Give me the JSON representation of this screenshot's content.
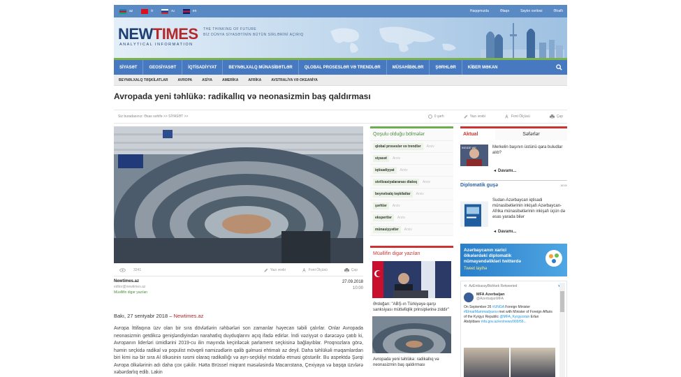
{
  "languages": [
    {
      "code": "az",
      "colors": [
        "#0092bc",
        "#e4002b",
        "#00af66"
      ]
    },
    {
      "code": "tr",
      "colors": [
        "#e30a17",
        "#e30a17",
        "#e30a17"
      ]
    },
    {
      "code": "ru",
      "colors": [
        "#ffffff",
        "#0039a6",
        "#d52b1e"
      ]
    },
    {
      "code": "en",
      "colors": [
        "#012169",
        "#c8102e",
        "#012169"
      ]
    }
  ],
  "toplinks": [
    "Haqqımızda",
    "Əlaqə",
    "Saytın xəritəsi",
    "Ətraflı"
  ],
  "logo": {
    "part1": "NEW",
    "part2": "TIMES",
    "sub": "ANALYTICAL INFORMATION"
  },
  "tagline": {
    "line1": "THE THINKING OF FUTURE",
    "line2": "BİZ DÜNYA SİYASƏTİNİN BÜTÜN SİRLƏRİNİ AÇIRIQ"
  },
  "nav": [
    "SİYASƏT",
    "GEOSİYASƏT",
    "İQTİSADİYYAT",
    "BEYNƏLXALQ MÜNASİBƏTLƏR",
    "QLOBAL PROSESLƏR VƏ TRENDLƏR",
    "MÜSAHİBƏLƏR",
    "ŞƏRHLƏR",
    "KİBER MƏKAN"
  ],
  "subnav": [
    "BEYNƏLXALQ TƏŞKİLATLAR",
    "AVROPA",
    "ASİYA",
    "AMERİKA",
    "AFRİKA",
    "AVSTRALİYA VƏ OKEANİYA"
  ],
  "article": {
    "title": "Avropada yeni təhlükə: radikallıq və neonasizmin baş qaldırması",
    "breadcrumb": "Siz buradasınız:  Əsas səhifə >> SİYASƏT >>",
    "tools": [
      "0 şərh",
      "Yazı ərəbi",
      "Font Ölçüsü",
      "Çap"
    ],
    "views": "3241",
    "photo_tools": [
      "Yazı ərəbi",
      "Font Ölçüsü",
      "Çap"
    ],
    "source_name": "Newtimes.az",
    "source_email": "editor@newtimes.az",
    "source_other": "Müəllifin digər yazıları",
    "date": "27.09.2018",
    "time": "10:00",
    "dateline_prefix": "Bakı, 27 sentyabr 2018 – ",
    "dateline_link": "Newtimes.az",
    "body": "Avropa İttifaqına üzv olan bir sıra dövlətlərin rəhbərləri son zamanlar həyecan təbili çalırlar. Onlar Avropada neonasizmin getdikcə genişləndiyindən narahatlıq duyduqlarını açıq ifadə edirlər. İndi vəziyyət o dərəcəyə çatıb ki, Avropanın liderləri ümidlərini 2019-cu ilin mayında keçiriləcək parlament seçkisinə bağlayıblar. Proqnozlara görə, həmin seçkidə radikal və populist mövqeli namizədlərin qalib gəlməsi ehtimalı az deyil. Daha təhlükəli məqamlardan biri kimi isə bir sıra Aİ ölkəsinin rəsmi olaraq radikallığı və ayrı-seçkiliyi müdafiə etməsi göstərilir. Bu aspektdə Şərqi Avropa ölkələrinin adı daha çox çəkilir. Hətta Brüssel miqrant məsələsində Macarıstana, Çexiyaya və başqa üzvlərə xəbərdarlıq edib. Lakin"
  },
  "related": {
    "title": "Qoşulu olduğu bölmələr",
    "tags": [
      "qlobal proseslər və trendlər",
      "siyasət",
      "iqtisadiyyat",
      "sivilizasiyalararası dialoq",
      "beynəlxalq təşkilatlar",
      "şərhlər",
      "ekspertlər",
      "münasiyyətlər"
    ],
    "more_label": "Arxiv"
  },
  "author_posts": {
    "title": "Müəllifin digər yazıları",
    "items": [
      {
        "caption": "Ərdoğan: \"ABŞ-ın Türkiyəyə qarşı sanksiyası müttəfiqlik prinsiplərinə ziddir\""
      },
      {
        "caption": "Avropada yeni təhlükə: radikallıq və neonasizmin baş qaldırması"
      }
    ]
  },
  "sidebar": {
    "tab_active": "Aktual",
    "tab_inactive": "Səfərlər",
    "top_news": "Merkelin başının üstünü qara buludlar alıb?",
    "more": "Davamı...",
    "section_title": "Diplomatik guşə",
    "section_archive": "arxiv",
    "diplo_news": "Sudan-Azərbaycan iqtisadi münasibətlərinin inkişafı Azərbaycan-Afrika münasibətlərinin inkişafı üçün də əsas yarada bilər",
    "banner_line1": "Azərbaycanın xarici",
    "banner_line2": "ölkələrdəki diplomatik",
    "banner_line3": "nümayəndəlikləri twitterdə",
    "banner_sub": "Tweet layihə",
    "tweet": {
      "retweet": "AzEmbassyBishkek Retweeted",
      "name": "MFA Azerbaijan",
      "handle": "@AzerbaijanMFA",
      "text1": "On September 26 ",
      "hash1": "#UNGA",
      "text2": " Foreign Minister ",
      "hash2": "#ElmarMammadyarov",
      "text3": " met with Minister of Foreign Affairs of the Kyrgyz Republic ",
      "hash3": "@MFA_Kyrgyzstan",
      "text4": " Erlan Abdyldaev ",
      "link": "mfa.gov.az/en/news/909/56..."
    }
  }
}
